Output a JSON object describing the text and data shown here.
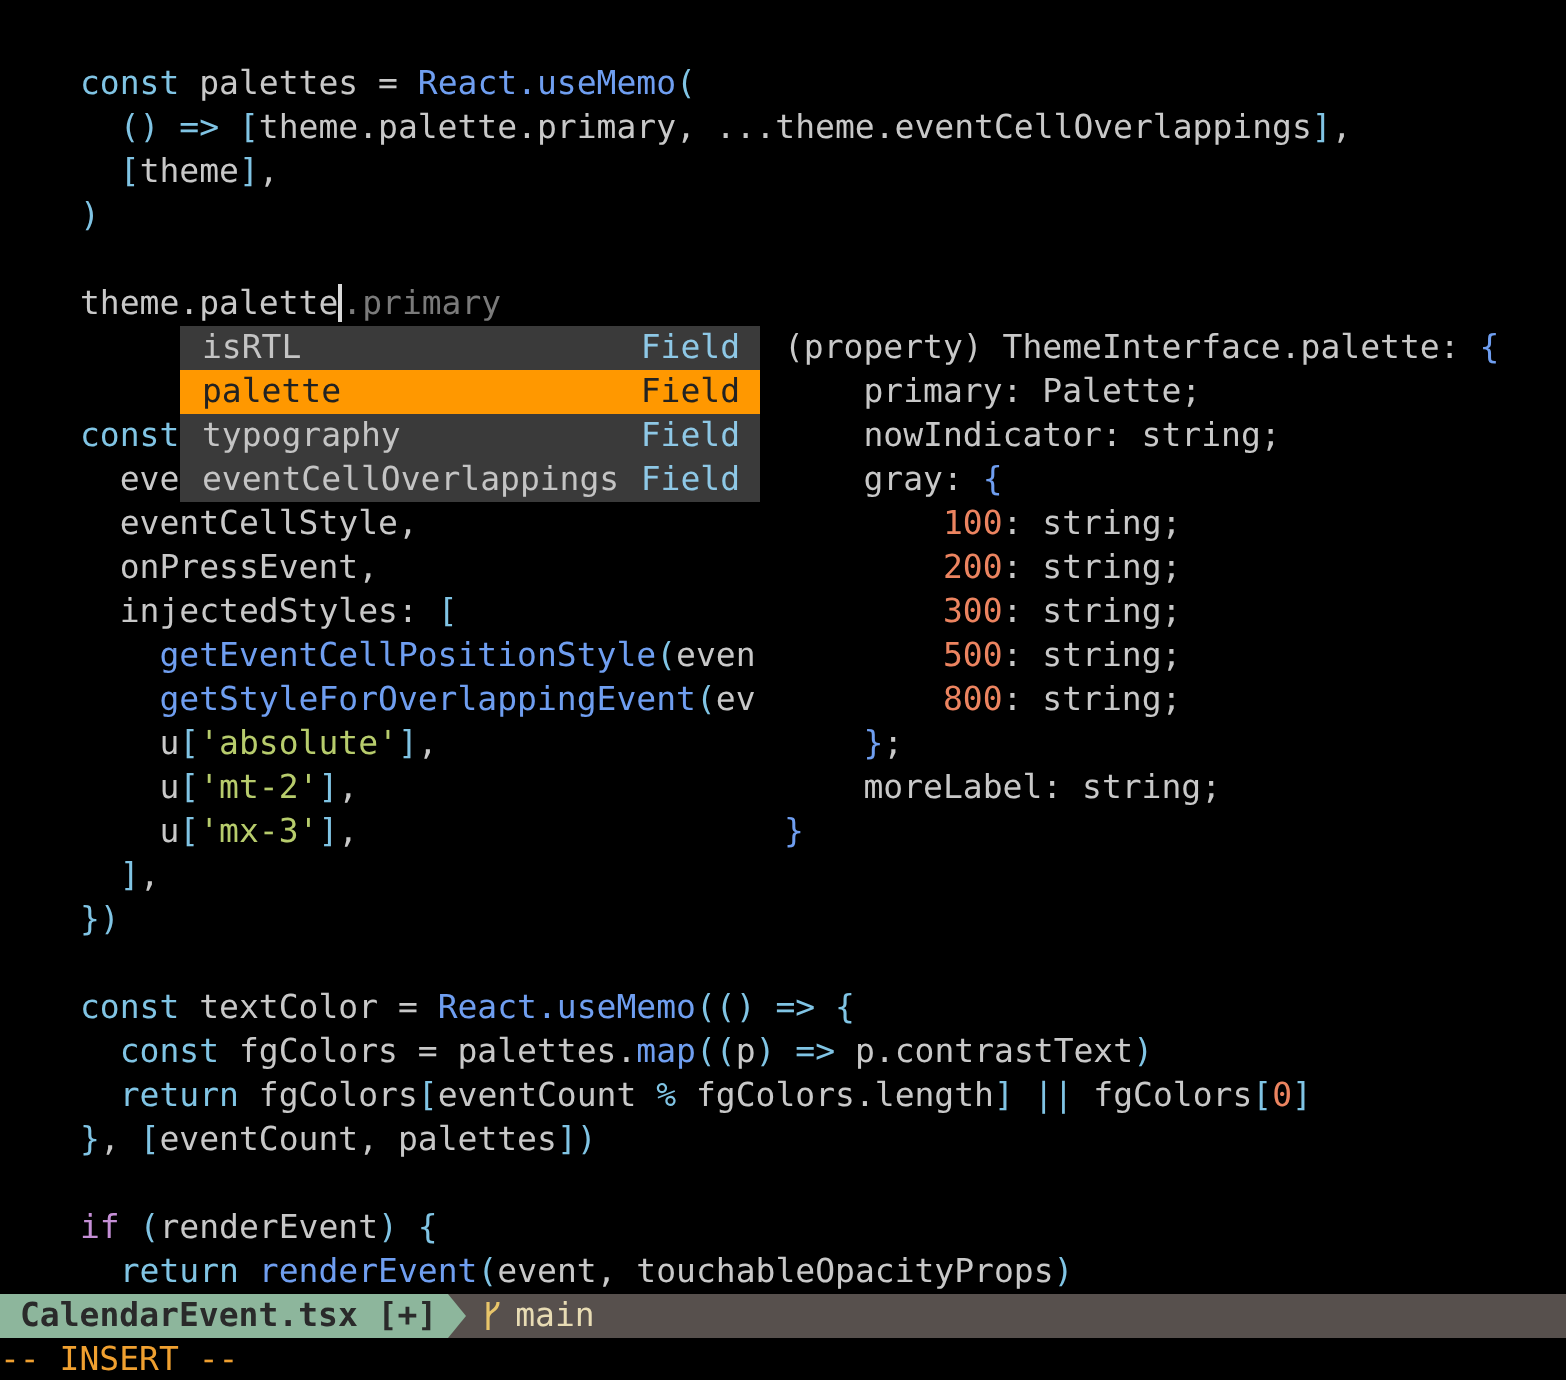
{
  "editor": {
    "lines": [
      {
        "kind": "blank"
      },
      {
        "kind": "code",
        "tokens": [
          {
            "kind": "keyword",
            "text": "const"
          },
          {
            "kind": "plain",
            "text": " palettes = "
          },
          {
            "kind": "function",
            "text": "React.useMemo"
          },
          {
            "kind": "punct",
            "text": "("
          }
        ]
      },
      {
        "kind": "code",
        "tokens": [
          {
            "kind": "punct",
            "text": "  () => ["
          },
          {
            "kind": "plain",
            "text": "theme.palette.primary, ...theme.eventCellOverlappings"
          },
          {
            "kind": "punct",
            "text": "]"
          },
          {
            "kind": "plain",
            "text": ","
          }
        ]
      },
      {
        "kind": "code",
        "tokens": [
          {
            "kind": "punct",
            "text": "  ["
          },
          {
            "kind": "plain",
            "text": "theme"
          },
          {
            "kind": "punct",
            "text": "]"
          },
          {
            "kind": "plain",
            "text": ","
          }
        ]
      },
      {
        "kind": "code",
        "tokens": [
          {
            "kind": "punct",
            "text": ")"
          }
        ]
      },
      {
        "kind": "blank"
      },
      {
        "kind": "code",
        "tokens": [
          {
            "kind": "plain",
            "text": "theme.palette",
            "cursor_after": true
          },
          {
            "kind": "ghost",
            "text": ".primary"
          }
        ]
      },
      {
        "kind": "blank"
      },
      {
        "kind": "blank"
      },
      {
        "kind": "code",
        "tokens": [
          {
            "kind": "keyword",
            "text": "const"
          }
        ]
      },
      {
        "kind": "code",
        "tokens": [
          {
            "kind": "plain",
            "text": "  eve"
          }
        ]
      },
      {
        "kind": "code",
        "tokens": [
          {
            "kind": "plain",
            "text": "  eventCellStyle,"
          }
        ]
      },
      {
        "kind": "code",
        "tokens": [
          {
            "kind": "plain",
            "text": "  onPressEvent,"
          }
        ]
      },
      {
        "kind": "code",
        "tokens": [
          {
            "kind": "plain",
            "text": "  injectedStyles: "
          },
          {
            "kind": "punct",
            "text": "["
          }
        ]
      },
      {
        "kind": "code",
        "tokens": [
          {
            "kind": "function",
            "text": "    getEventCellPositionStyle"
          },
          {
            "kind": "punct",
            "text": "("
          },
          {
            "kind": "plain",
            "text": "even"
          }
        ]
      },
      {
        "kind": "code",
        "tokens": [
          {
            "kind": "function",
            "text": "    getStyleForOverlappingEvent"
          },
          {
            "kind": "punct",
            "text": "("
          },
          {
            "kind": "plain",
            "text": "ev"
          }
        ]
      },
      {
        "kind": "code",
        "tokens": [
          {
            "kind": "plain",
            "text": "    u"
          },
          {
            "kind": "punct",
            "text": "["
          },
          {
            "kind": "string",
            "text": "'absolute'"
          },
          {
            "kind": "punct",
            "text": "]"
          },
          {
            "kind": "plain",
            "text": ","
          }
        ]
      },
      {
        "kind": "code",
        "tokens": [
          {
            "kind": "plain",
            "text": "    u"
          },
          {
            "kind": "punct",
            "text": "["
          },
          {
            "kind": "string",
            "text": "'mt-2'"
          },
          {
            "kind": "punct",
            "text": "]"
          },
          {
            "kind": "plain",
            "text": ","
          }
        ]
      },
      {
        "kind": "code",
        "tokens": [
          {
            "kind": "plain",
            "text": "    u"
          },
          {
            "kind": "punct",
            "text": "["
          },
          {
            "kind": "string",
            "text": "'mx-3'"
          },
          {
            "kind": "punct",
            "text": "]"
          },
          {
            "kind": "plain",
            "text": ","
          }
        ]
      },
      {
        "kind": "code",
        "tokens": [
          {
            "kind": "punct",
            "text": "  ]"
          },
          {
            "kind": "plain",
            "text": ","
          }
        ]
      },
      {
        "kind": "code",
        "tokens": [
          {
            "kind": "punct",
            "text": "})"
          }
        ]
      },
      {
        "kind": "blank"
      },
      {
        "kind": "code",
        "tokens": [
          {
            "kind": "keyword",
            "text": "const"
          },
          {
            "kind": "plain",
            "text": " textColor = "
          },
          {
            "kind": "function",
            "text": "React.useMemo"
          },
          {
            "kind": "punct",
            "text": "(() => {"
          }
        ]
      },
      {
        "kind": "code",
        "tokens": [
          {
            "kind": "keyword",
            "text": "  const"
          },
          {
            "kind": "plain",
            "text": " fgColors = palettes."
          },
          {
            "kind": "function",
            "text": "map"
          },
          {
            "kind": "punct",
            "text": "(("
          },
          {
            "kind": "plain",
            "text": "p"
          },
          {
            "kind": "punct",
            "text": ") =>"
          },
          {
            "kind": "plain",
            "text": " p.contrastText"
          },
          {
            "kind": "punct",
            "text": ")"
          }
        ]
      },
      {
        "kind": "code",
        "tokens": [
          {
            "kind": "keyword",
            "text": "  return"
          },
          {
            "kind": "plain",
            "text": " fgColors"
          },
          {
            "kind": "punct",
            "text": "["
          },
          {
            "kind": "plain",
            "text": "eventCount "
          },
          {
            "kind": "punct",
            "text": "%"
          },
          {
            "kind": "plain",
            "text": " fgColors.length"
          },
          {
            "kind": "punct",
            "text": "] ||"
          },
          {
            "kind": "plain",
            "text": " fgColors"
          },
          {
            "kind": "punct",
            "text": "["
          },
          {
            "kind": "number",
            "text": "0"
          },
          {
            "kind": "punct",
            "text": "]"
          }
        ]
      },
      {
        "kind": "code",
        "tokens": [
          {
            "kind": "punct",
            "text": "}"
          },
          {
            "kind": "plain",
            "text": ", "
          },
          {
            "kind": "punct",
            "text": "["
          },
          {
            "kind": "plain",
            "text": "eventCount, palettes"
          },
          {
            "kind": "punct",
            "text": "])"
          }
        ]
      },
      {
        "kind": "blank"
      },
      {
        "kind": "code",
        "tokens": [
          {
            "kind": "control",
            "text": "if"
          },
          {
            "kind": "punct",
            "text": " ("
          },
          {
            "kind": "plain",
            "text": "renderEvent"
          },
          {
            "kind": "punct",
            "text": ") {"
          }
        ]
      },
      {
        "kind": "code",
        "tokens": [
          {
            "kind": "keyword",
            "text": "  return"
          },
          {
            "kind": "function",
            "text": " renderEvent"
          },
          {
            "kind": "punct",
            "text": "("
          },
          {
            "kind": "plain",
            "text": "event, touchableOpacityProps"
          },
          {
            "kind": "punct",
            "text": ")"
          }
        ]
      }
    ]
  },
  "completion_menu": {
    "items": [
      {
        "label": "isRTL",
        "type": "Field",
        "selected": false
      },
      {
        "label": "palette",
        "type": "Field",
        "selected": true
      },
      {
        "label": "typography",
        "type": "Field",
        "selected": false
      },
      {
        "label": "eventCellOverlappings",
        "type": "Field",
        "selected": false
      }
    ]
  },
  "hover_doc": {
    "lines": [
      {
        "kind": "code",
        "tokens": [
          {
            "kind": "plain",
            "text": "(property) ThemeInterface.palette: "
          },
          {
            "kind": "punct2",
            "text": "{"
          }
        ]
      },
      {
        "kind": "code",
        "tokens": [
          {
            "kind": "plain",
            "text": "    primary: Palette;"
          }
        ]
      },
      {
        "kind": "code",
        "tokens": [
          {
            "kind": "plain",
            "text": "    nowIndicator: string;"
          }
        ]
      },
      {
        "kind": "code",
        "tokens": [
          {
            "kind": "plain",
            "text": "    gray: "
          },
          {
            "kind": "punct2",
            "text": "{"
          }
        ]
      },
      {
        "kind": "code",
        "tokens": [
          {
            "kind": "number",
            "text": "        100"
          },
          {
            "kind": "plain",
            "text": ": string;"
          }
        ]
      },
      {
        "kind": "code",
        "tokens": [
          {
            "kind": "number",
            "text": "        200"
          },
          {
            "kind": "plain",
            "text": ": string;"
          }
        ]
      },
      {
        "kind": "code",
        "tokens": [
          {
            "kind": "number",
            "text": "        300"
          },
          {
            "kind": "plain",
            "text": ": string;"
          }
        ]
      },
      {
        "kind": "code",
        "tokens": [
          {
            "kind": "number",
            "text": "        500"
          },
          {
            "kind": "plain",
            "text": ": string;"
          }
        ]
      },
      {
        "kind": "code",
        "tokens": [
          {
            "kind": "number",
            "text": "        800"
          },
          {
            "kind": "plain",
            "text": ": string;"
          }
        ]
      },
      {
        "kind": "code",
        "tokens": [
          {
            "kind": "punct2",
            "text": "    }"
          },
          {
            "kind": "plain",
            "text": ";"
          }
        ]
      },
      {
        "kind": "code",
        "tokens": [
          {
            "kind": "plain",
            "text": "    moreLabel: string;"
          }
        ]
      },
      {
        "kind": "code",
        "tokens": [
          {
            "kind": "punct2",
            "text": "}"
          }
        ]
      }
    ]
  },
  "status_bar": {
    "file": "CalendarEvent.tsx [+]",
    "branch": "main"
  },
  "mode_line": "-- INSERT --"
}
